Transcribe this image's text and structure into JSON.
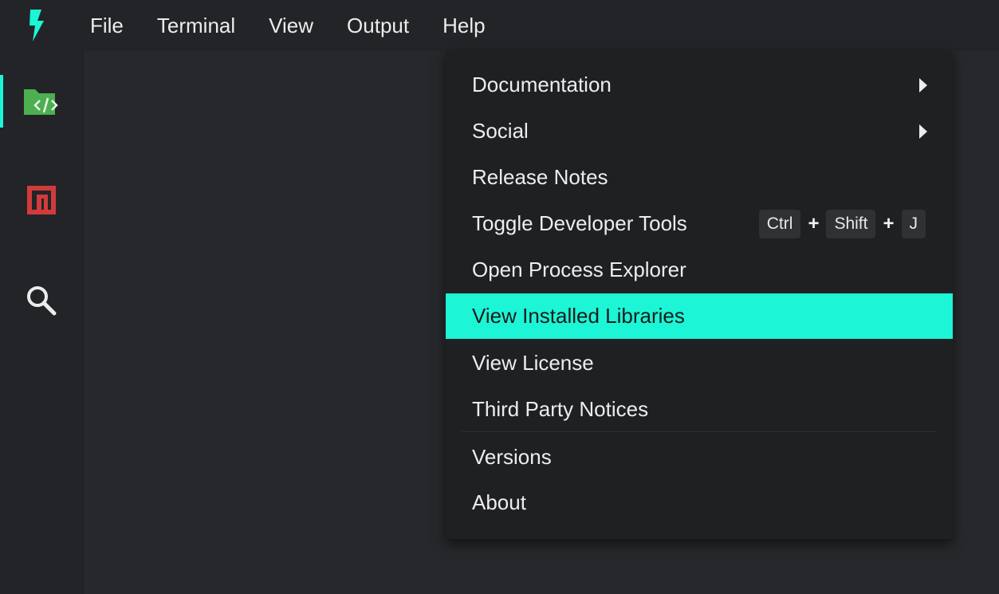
{
  "menubar": {
    "logo_icon": "bolt-icon",
    "items": [
      "File",
      "Terminal",
      "View",
      "Output",
      "Help"
    ]
  },
  "activitybar": {
    "items": [
      {
        "icon": "folder-code-icon",
        "active": true
      },
      {
        "icon": "npm-icon",
        "active": false
      },
      {
        "icon": "search-icon",
        "active": false
      }
    ]
  },
  "help_menu": {
    "items": [
      {
        "label": "Documentation",
        "submenu": true
      },
      {
        "label": "Social",
        "submenu": true
      },
      {
        "label": "Release Notes"
      },
      {
        "label": "Toggle Developer Tools",
        "shortcut": {
          "keys": [
            "Ctrl",
            "Shift",
            "J"
          ],
          "separator": "+"
        }
      },
      {
        "label": "Open Process Explorer"
      },
      {
        "label": "View Installed Libraries",
        "highlighted": true
      },
      {
        "label": "View License"
      },
      {
        "label": "Third Party Notices"
      },
      {
        "label": "Versions"
      },
      {
        "label": "About"
      }
    ]
  },
  "colors": {
    "accent": "#1cf5d6",
    "background": "#27282b",
    "menubar": "#232427",
    "dropdown": "#1f2022",
    "folder_icon": "#4caf50",
    "npm_icon": "#d13b3b"
  }
}
